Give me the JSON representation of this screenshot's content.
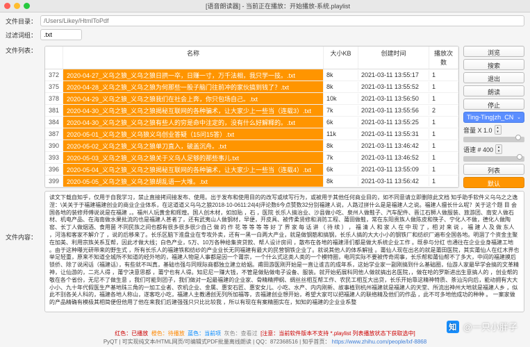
{
  "title": "[语音朗读器] - 当前正在播放：开始播放-系统.playlist",
  "labels": {
    "dir": "文件目录：",
    "filter": "过滤词组：",
    "list": "文件列表：",
    "content": "文件内容："
  },
  "dir_placeholder": "/Users/Likey/HtmlToPdf",
  "filter_value": ".txt",
  "cols": {
    "name": "名称",
    "size": "大小KB",
    "time": "创建时间",
    "count": "播放次数"
  },
  "rows": [
    {
      "idx": "372",
      "name": "2020-04-27_义乌之狼_义乌之狼日拱一卒，日赚一寸，万千法相，我只学一技。.txt",
      "size": "8k",
      "time": "2021-03-11 13:55:17",
      "count": "1"
    },
    {
      "idx": "375",
      "name": "2020-04-28_义乌之狼_义乌之狼为何那些一股子脑门往前冲的家伙搞到钱了？.txt",
      "size": "8k",
      "time": "2021-03-11 13:55:52",
      "count": "1"
    },
    {
      "idx": "378",
      "name": "2020-04-29_义乌之狼_义乌之狼我们在社会上奔，你只包场自己。.txt",
      "size": "10k",
      "time": "2021-03-11 13:56:50",
      "count": "1"
    },
    {
      "idx": "381",
      "name": "2020-04-30_义乌之狼_义乌之狼揭秘互联网的各种骗术，让大家少上一些当（连载3）.txt",
      "size": "7k",
      "time": "2021-03-11 13:55:56",
      "count": "2"
    },
    {
      "idx": "384",
      "name": "2020-04-30_义乌之狼_义乌之狼有些人的穷是命中注定的，没有什么好解释的。.txt",
      "size": "6k",
      "time": "2021-03-11 13:55:25",
      "count": "1"
    },
    {
      "idx": "387",
      "name": "2020-05-01_义乌之狼_义乌狼义乌创业答疑（15问15答）.txt",
      "size": "11k",
      "time": "2021-03-11 13:55:31",
      "count": "1"
    },
    {
      "idx": "390",
      "name": "2020-05-02_义乌之狼_义乌之狼单刀直入，破盖沉舟。.txt",
      "size": "8k",
      "time": "2021-03-11 13:46:42",
      "count": "1"
    },
    {
      "idx": "393",
      "name": "2020-05-03_义乌之狼_义乌之狼关于义乌人足够的那些事儿.txt",
      "size": "7k",
      "time": "2021-03-11 13:46:52",
      "count": "1"
    },
    {
      "idx": "396",
      "name": "2020-05-04_义乌之狼_义乌之狼揭秘互联网的各种骗术，让大家少上一些当（连载4）.txt",
      "size": "6k",
      "time": "2021-03-11 13:55:09",
      "count": "1"
    },
    {
      "idx": "399",
      "name": "2020-05-05_义乌之狼_义乌之狼胡乱语一大堆。.txt",
      "size": "8k",
      "time": "2021-03-11 13:56:42",
      "count": "1"
    }
  ],
  "buttons": {
    "browse": "浏览",
    "search": "搜索",
    "exit": "退出",
    "read": "朗读",
    "stop": "停止",
    "list": "列表",
    "default": "默认"
  },
  "voice_select": "Ting-Ting|zh_CN",
  "volume_label": "音量 X 1.0",
  "speed_label": "语速 # 400",
  "content": "读文下载自知乎，仅用于自我学习，禁止直接拷间接发布、使用。出于发布和使用目的的改写或续写行为，或被用于其他任何商业目的，如不同意请立即删除此文档 知乎助手软件义乌乌之之逸涅：\\关关于于福建福建创业的商业企业体系，在这道道义乌乌之狼2018-10-0611:24|4|评论数6今点赞数32分别福建人说，人路过拼什么是是福建人之说。福建人擅长什么呢？关于这个题 目 会国各地的装修师傅说说是在福建 ，。福州人玩黄金和辉煌。国人创木材，如加贴 ，石 ，医院 长乐人搞治业、沙县做小吃、泉州人做鞋子、汽车配件、晋江石狮人做服装、旅游团、南安人做石材、机电产品、在海南做水果批流的也是福建人甚者了，还有武夷山人做钢材，早便，开皮具、被传柔贤修和消防工程、莆田做鞋，常在东阳贵族人做陈皮和筷子、宁化人不做，德化人做陶窑、长丁人做烟酒、食用菌 不同民族之间也都有很多很多很少自己 做 的 作 花 等 等 等 等 好 了 界 家 每 话 讲 （ 待 续 ） ， 福 清 人 和 家 人 在 中 现 了 ，相 对 来 说 ， 福 建 人 及 做 东人 ，河洛和客家不解介了 ，说的后移来了。长乐区脑下淮盘业在专攻外卖，还有一黑一白两大产业，就是做钢筋和搞钢，长乐人搞的大大小小的钢铁厂和纺织厂遍布全国各地。明涸了个资金主聚在加美、利用宗族关系互帮，因此才做大线；白色产业，5万、10万各种给集资贷款、帮人设计房间 ，散布在各地的福建泽们都是做大系统企业工作 。既参与分红 也通往在企业业身福建工地 。由于这种曝光研带来的野生式 ，所有长乐人的福建铁和纺纱的产业业长无同福建有最大的民营钢铁企业了。就说其他人的体系解挂 。莆仙人现在出名的就是莆田医院，其实莆仙人在红木界也举足轻重，原来不知道全城所不知道的经外地的，福建人物是人事都是因一个莆宗，一个什么式这类人类的一个模特圈，电同实际不要被传奇闹事，长乐帮和莆仙帮不了多大，中间的福建摸后锁侨、除了说闲话（福建话），有些就不叫真，基础也强与同规际商都独立建立给姻。甫田游医刚开始是一直让谁吉的成年系，这始学业家一副刚搞到什么基础圈，仙游人家最早学会搞的文革精神，让仙游的，二兆人得 ，莆宁决意思都 ，莆宁也有人得。知尼尼一赚大钱，不管是做贴做电子设备、服装。就开始拓展科同他人做就搞出名医院，，做在哈的罗斯进出生意搞人的 ，创业帮的敬在各个省份，无尼不了做生意 ，我们可能到团子，我们做对一起最福建的企业家、骨精精押纲、绸丝丝相互帮工作、农民工相互大出贷，长乐开始靠这精神特质、茶汕沟向后，能动拥有大大小小、九十年代假医生产基地珠三角的一加工业者、农机企业、金属、惠安石匠、惠安女儿、小吃、水产、内内刚新、故事植到杭州福建就是福建人的天堂、所流出神州大地就是福建人乡 ，似此不别各关人科的，福建各地人称山，遂客吃小吃，福建人主教通创无列所加福等，去福建创业想开始，希望大家可以把福建人的联络精及他们的作品 ，此不可多地他成功的种种 。 一案家做的产品精确有模极其相简便但他用了他在来我们后建强强只只比比较我 ，所以有现在有案精圈实在，知知的福建的企业业系整",
  "status_line": {
    "red": "红色：已播放",
    "orange": "橙色：待播放",
    "blue": "蓝色：当前项",
    "gray": "灰色：查看过",
    "note": "[注意：当前软件版本不支持 *.playlist 列表播放状态下获取选中]"
  },
  "footer": {
    "prefix": "PyQT | 可实现纯文本/HTML网页/可编辑式PDF批量离线朗读 | ",
    "qq": "QQ：872368516",
    "sep": " | 知乎首页：",
    "url": "https://www.zhihu.com/people/lxf-8868"
  },
  "watermark": "@一只小胖子"
}
